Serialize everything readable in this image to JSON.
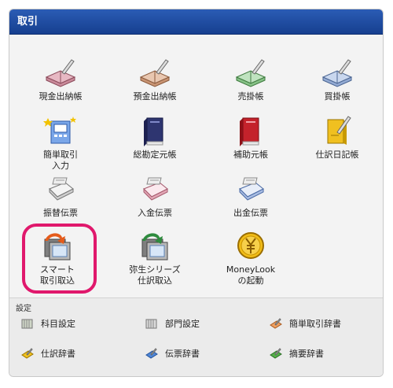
{
  "header": {
    "title": "取引"
  },
  "main": {
    "items": [
      {
        "label": "現金出納帳",
        "icon": "cash-book-icon"
      },
      {
        "label": "預金出納帳",
        "icon": "deposit-book-icon"
      },
      {
        "label": "売掛帳",
        "icon": "receivable-book-icon"
      },
      {
        "label": "買掛帳",
        "icon": "payable-book-icon"
      },
      {
        "label": "簡単取引\n入力",
        "icon": "simple-entry-icon"
      },
      {
        "label": "総勘定元帳",
        "icon": "general-ledger-icon"
      },
      {
        "label": "補助元帳",
        "icon": "sub-ledger-icon"
      },
      {
        "label": "仕訳日記帳",
        "icon": "journal-icon"
      },
      {
        "label": "振替伝票",
        "icon": "transfer-slip-icon"
      },
      {
        "label": "入金伝票",
        "icon": "receipt-slip-icon"
      },
      {
        "label": "出金伝票",
        "icon": "payment-slip-icon"
      },
      {
        "label": "スマート\n取引取込",
        "icon": "smart-import-icon"
      },
      {
        "label": "弥生シリーズ\n仕訳取込",
        "icon": "yayoi-import-icon"
      },
      {
        "label": "MoneyLook\nの起動",
        "icon": "moneylook-coin-icon"
      }
    ]
  },
  "settings": {
    "title": "設定",
    "items": [
      {
        "label": "科目設定",
        "icon": "account-settings-icon"
      },
      {
        "label": "部門設定",
        "icon": "department-settings-icon"
      },
      {
        "label": "簡単取引辞書",
        "icon": "simple-dictionary-icon"
      },
      {
        "label": "仕訳辞書",
        "icon": "journal-dictionary-icon"
      },
      {
        "label": "伝票辞書",
        "icon": "slip-dictionary-icon"
      },
      {
        "label": "摘要辞書",
        "icon": "summary-dictionary-icon"
      }
    ]
  }
}
